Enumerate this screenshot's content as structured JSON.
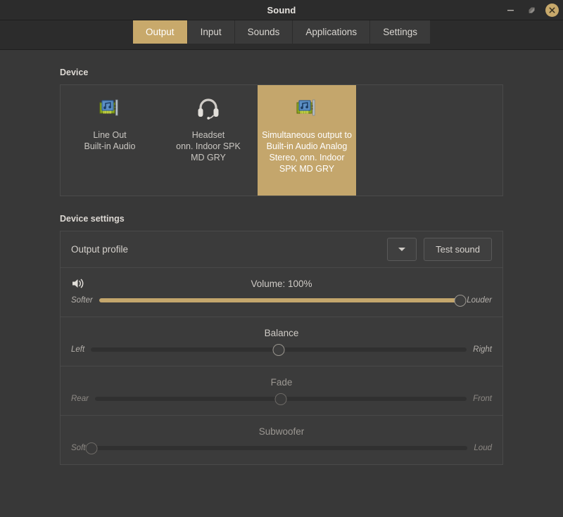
{
  "window": {
    "title": "Sound",
    "controls": [
      {
        "name": "minimize-button",
        "glyph": "minimize"
      },
      {
        "name": "maximize-button",
        "glyph": "maximize"
      },
      {
        "name": "close-button",
        "glyph": "close"
      }
    ]
  },
  "tabs": [
    {
      "label": "Output",
      "active": true
    },
    {
      "label": "Input",
      "active": false
    },
    {
      "label": "Sounds",
      "active": false
    },
    {
      "label": "Applications",
      "active": false
    },
    {
      "label": "Settings",
      "active": false
    }
  ],
  "device_section": {
    "heading": "Device",
    "cards": [
      {
        "icon": "audio-card-icon",
        "name": "Line Out\nBuilt-in Audio",
        "selected": false
      },
      {
        "icon": "headset-icon",
        "name": "Headset\nonn. Indoor SPK\nMD GRY",
        "selected": false
      },
      {
        "icon": "audio-card-icon",
        "name": "Simultaneous output to Built-in Audio Analog Stereo, onn. Indoor SPK MD GRY",
        "selected": true
      }
    ]
  },
  "device_settings": {
    "heading": "Device settings",
    "profile": {
      "label": "Output profile",
      "selected_value": "",
      "dropdown_icon": "chevron-down-icon",
      "test_button": "Test sound"
    },
    "sliders": [
      {
        "key": "volume",
        "title": "Volume: 100%",
        "icon": "speaker-volume-icon",
        "left_label": "Softer",
        "right_label": "Louder",
        "value_percent": 100,
        "filled": true,
        "enabled": true
      },
      {
        "key": "balance",
        "title": "Balance",
        "icon": "",
        "left_label": "Left",
        "right_label": "Right",
        "value_percent": 50,
        "filled": false,
        "enabled": true
      },
      {
        "key": "fade",
        "title": "Fade",
        "icon": "",
        "left_label": "Rear",
        "right_label": "Front",
        "value_percent": 50,
        "filled": false,
        "enabled": false
      },
      {
        "key": "subwoofer",
        "title": "Subwoofer",
        "icon": "",
        "left_label": "Soft",
        "right_label": "Loud",
        "value_percent": 0,
        "filled": false,
        "enabled": false
      }
    ]
  },
  "colors": {
    "accent": "#c4a66c",
    "titlebar_bg": "#2c2c2c",
    "window_bg": "#383838",
    "panel_bg": "#3b3b3b",
    "text": "#d6d2cd"
  }
}
